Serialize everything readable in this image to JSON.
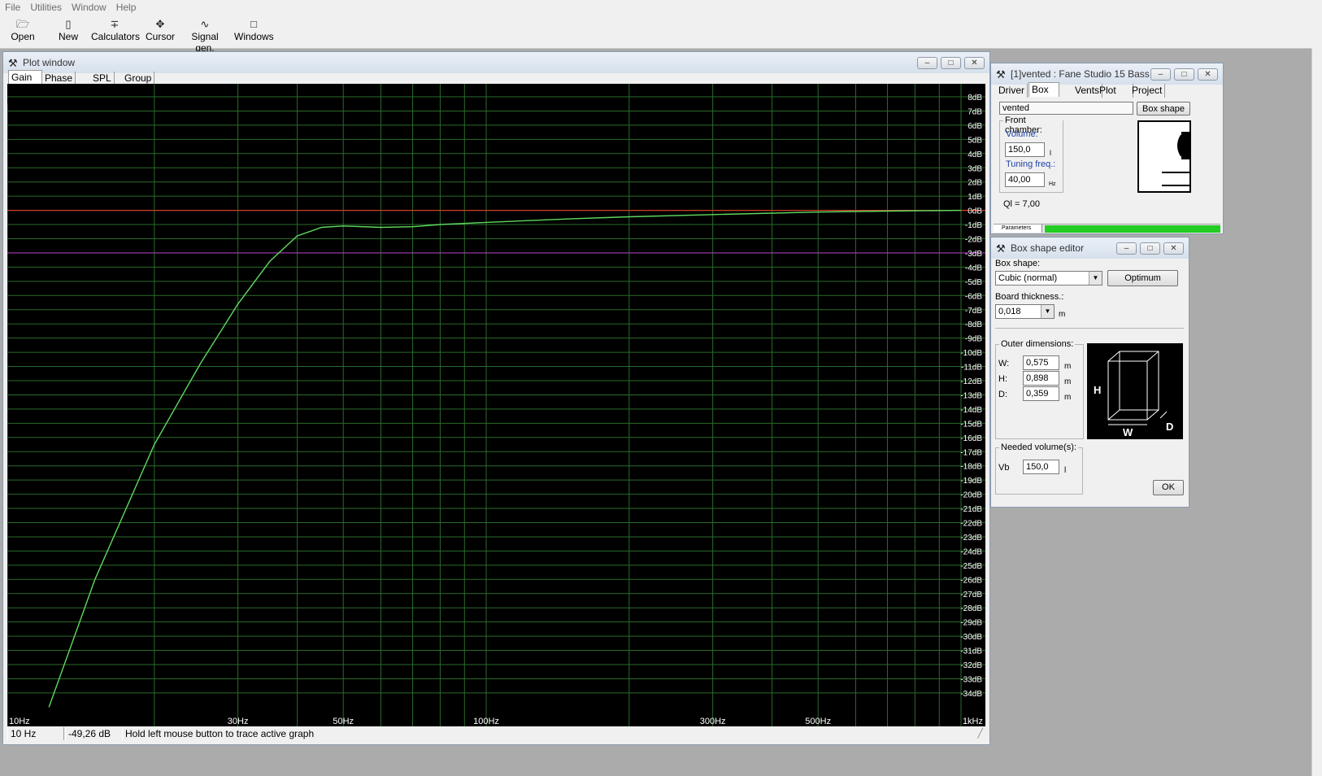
{
  "menu": [
    "File",
    "Utilities",
    "Window",
    "Help"
  ],
  "toolbar": [
    {
      "label": "Open",
      "icon": "open-folder-icon"
    },
    {
      "label": "New",
      "icon": "new-document-icon"
    },
    {
      "label": "Calculators",
      "icon": "calculator-icon"
    },
    {
      "label": "Cursor",
      "icon": "cursor-icon"
    },
    {
      "label": "Signal gen.",
      "icon": "signal-generator-icon"
    },
    {
      "label": "Windows",
      "icon": "windows-icon"
    }
  ],
  "plot_window": {
    "title": "Plot window",
    "tabs": [
      "Gain",
      "Phase plot",
      "SPL",
      "Group delay"
    ],
    "active_tab": "Gain",
    "status": {
      "freq": "10 Hz",
      "value": "-49,26 dB",
      "hint": "Hold left mouse button to trace active graph"
    }
  },
  "chart_data": {
    "type": "line",
    "title": "",
    "xlabel": "",
    "ylabel": "",
    "x_scale": "log",
    "xlim": [
      10,
      1000
    ],
    "ylim": [
      -35,
      8.5
    ],
    "x_tick_labels": [
      {
        "v": 10,
        "t": "10Hz"
      },
      {
        "v": 30,
        "t": "30Hz"
      },
      {
        "v": 50,
        "t": "50Hz"
      },
      {
        "v": 100,
        "t": "100Hz"
      },
      {
        "v": 300,
        "t": "300Hz"
      },
      {
        "v": 500,
        "t": "500Hz"
      },
      {
        "v": 1000,
        "t": "1kHz"
      }
    ],
    "y_tick_labels": [
      "8dB",
      "7dB",
      "6dB",
      "5dB",
      "4dB",
      "3dB",
      "2dB",
      "1dB",
      "0dB",
      "-1dB",
      "-2dB",
      "-3dB",
      "-4dB",
      "-5dB",
      "-6dB",
      "-7dB",
      "-8dB",
      "-9dB",
      "-10dB",
      "-11dB",
      "-12dB",
      "-13dB",
      "-14dB",
      "-15dB",
      "-16dB",
      "-17dB",
      "-18dB",
      "-19dB",
      "-20dB",
      "-21dB",
      "-22dB",
      "-23dB",
      "-24dB",
      "-25dB",
      "-26dB",
      "-27dB",
      "-28dB",
      "-29dB",
      "-30dB",
      "-31dB",
      "-32dB",
      "-33dB",
      "-34dB"
    ],
    "grid": true,
    "reference_lines": [
      {
        "y": 0,
        "color": "#d23c28"
      },
      {
        "y": -3,
        "color": "#a43cb4"
      }
    ],
    "series": [
      {
        "color": "#5fd85f",
        "x": [
          12,
          15,
          20,
          25,
          30,
          35,
          40,
          45,
          50,
          60,
          70,
          80,
          100,
          150,
          200,
          300,
          500,
          700,
          1000
        ],
        "y": [
          -35,
          -26,
          -16.5,
          -10.8,
          -6.6,
          -3.6,
          -1.8,
          -1.2,
          -1.1,
          -1.2,
          -1.15,
          -1.0,
          -0.85,
          -0.6,
          -0.45,
          -0.3,
          -0.12,
          -0.05,
          0
        ]
      }
    ]
  },
  "vented_window": {
    "title": "[1]vented : Fane Studio 15 Bass",
    "tabs": [
      "Driver",
      "Box",
      "Vents",
      "Plot",
      "Project"
    ],
    "active_tab": "Box",
    "name_value": "vented",
    "box_shape_button": "Box shape",
    "front_chamber_label": "Front chamber:",
    "volume_label": "Volume:",
    "volume_value": "150,0",
    "volume_unit": "l",
    "tuning_label": "Tuning freq.:",
    "tuning_value": "40,00",
    "tuning_unit": "Hz",
    "ql_text": "Ql = 7,00",
    "parameters_tab": "Parameters",
    "progress_color": "#22cc22"
  },
  "box_editor": {
    "title": "Box shape editor",
    "box_shape_label": "Box shape:",
    "box_shape_value": "Cubic (normal)",
    "optimum_button": "Optimum",
    "board_label": "Board thickness.:",
    "board_value": "0,018",
    "board_unit": "m",
    "outer_label": "Outer dimensions:",
    "dims": [
      {
        "label": "W:",
        "value": "0,575",
        "unit": "m"
      },
      {
        "label": "H:",
        "value": "0,898",
        "unit": "m"
      },
      {
        "label": "D:",
        "value": "0,359",
        "unit": "m"
      }
    ],
    "diagram_labels": {
      "h": "H",
      "w": "W",
      "d": "D"
    },
    "needed_label": "Needed volume(s):",
    "vb_label": "Vb",
    "vb_value": "150,0",
    "vb_unit": "l",
    "ok_button": "OK"
  }
}
